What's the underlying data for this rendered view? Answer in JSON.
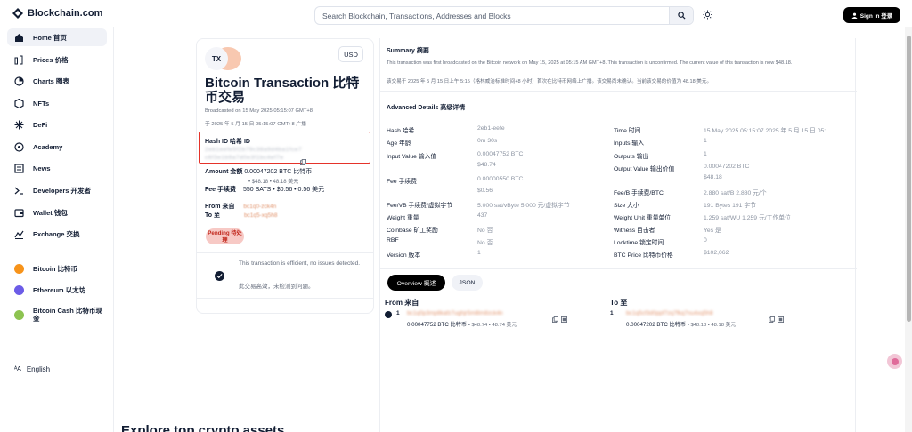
{
  "brand": {
    "name": "Blockchain.com",
    "color": "#121d33"
  },
  "search": {
    "placeholder": "Search Blockchain, Transactions, Addresses and Blocks"
  },
  "header": {
    "sign_in": "Sign In 登录"
  },
  "sidebar": {
    "items": [
      {
        "label": "Home 首页",
        "icon": "home-icon"
      },
      {
        "label": "Prices 价格",
        "icon": "prices-icon"
      },
      {
        "label": "Charts 图表",
        "icon": "charts-icon"
      },
      {
        "label": "NFTs",
        "icon": "nft-icon"
      },
      {
        "label": "DeFi",
        "icon": "defi-icon"
      },
      {
        "label": "Academy",
        "icon": "academy-icon"
      },
      {
        "label": "News",
        "icon": "news-icon"
      },
      {
        "label": "Developers 开发者",
        "icon": "terminal-icon"
      },
      {
        "label": "Wallet 钱包",
        "icon": "wallet-icon"
      },
      {
        "label": "Exchange 交换",
        "icon": "exchange-icon"
      }
    ],
    "coins": [
      {
        "label": "Bitcoin 比特币",
        "color": "#f7931a"
      },
      {
        "label": "Ethereum 以太坊",
        "color": "#6c5ce7"
      },
      {
        "label": "Bitcoin Cash 比特币现金",
        "color": "#8dc351"
      }
    ],
    "language": "English"
  },
  "tx": {
    "badge": "TX",
    "currency": "USD",
    "title": "Bitcoin Transaction 比特币交易",
    "broadcast_en": "Broadcasted on 15 May 2025 05:15:07 GMT+8",
    "broadcast_zh": "于 2025 年 5 月 15 日 05:15:07 GMT+8 广播",
    "hash_label": "Hash ID 哈希 ID",
    "hash_value_1": "2eb1eefe5f2b79c38a9d4ba1fce7",
    "hash_value_2": "c6f3e1b9a7d0e3f1bc4ef7e",
    "amount_label": "Amount 金额",
    "amount_value": "0.00047202 BTC 比特币",
    "amount_usd": "• $48.18 • 48.18 美元",
    "fee_label": "Fee 手续费",
    "fee_value": "550 SATS • $0.56 • 0.56 美元",
    "from_label": "From 来自",
    "from_value": "bc1q0-zck4n",
    "to_label": "To 至",
    "to_value": "bc1q5-xq5h8",
    "status": "Pending 待处理",
    "efficient_en": "This transaction is efficient, no issues detected.",
    "efficient_zh": "此交易高效，未检测到问题。"
  },
  "summary": {
    "title": "Summary 摘要",
    "text_en": "This transaction was first broadcasted on the Bitcoin network on May 15, 2025 at 05:15 AM GMT+8. This transaction is unconfirmed. The current value of this transaction is now $48.18.",
    "text_zh": "该交易于 2025 年 5 月 15 日上午 5:15（格林威治标准时间+8 小时）首次在比特币网络上广播。该交易尚未确认。当前该交易的价值为 48.18 美元。"
  },
  "advanced": {
    "title": "Advanced Details 高级详情",
    "left": [
      {
        "k": "Hash 哈希",
        "v": "2eb1-eefe"
      },
      {
        "k": "Age 年龄",
        "v": "0m 30s"
      },
      {
        "k": "Input Value 输入值",
        "v": "0.00047752 BTC",
        "v2": "$48.74"
      },
      {
        "k": "Fee 手续费",
        "v": "0.00000550 BTC",
        "v2": "$0.56"
      },
      {
        "k": "Fee/VB 手续费/虚拟字节",
        "v": "5.000 sat/vByte 5.000 元/虚拟字节"
      },
      {
        "k": "Weight 重量",
        "v": "437"
      },
      {
        "k": "Coinbase 矿工奖励",
        "v": "No 否"
      },
      {
        "k": "RBF",
        "v": "No 否"
      },
      {
        "k": "Version 版本",
        "v": "1"
      }
    ],
    "right": [
      {
        "k": "Time 时间",
        "v": "15 May 2025 05:15:07 2025 年 5 月 15 日 05:"
      },
      {
        "k": "Inputs 输入",
        "v": "1"
      },
      {
        "k": "Outputs 输出",
        "v": "1"
      },
      {
        "k": "Output Value 输出价值",
        "v": "0.00047202 BTC",
        "v2": "$48.18"
      },
      {
        "k": "Fee/B 手续费/BTC",
        "v": "2.880 sat/B 2.880 元/个"
      },
      {
        "k": "Size 大小",
        "v": "191 Bytes 191 字节"
      },
      {
        "k": "Weight Unit 重量单位",
        "v": "1.259 sat/WU 1.259 元/工作单位"
      },
      {
        "k": "Witness 目击者",
        "v": "Yes 是"
      },
      {
        "k": "Locktime 锁定时间",
        "v": "0"
      },
      {
        "k": "BTC Price 比特币价格",
        "v": "$102,062"
      }
    ]
  },
  "tabs": {
    "overview": "Overview 概述",
    "json": "JSON"
  },
  "io": {
    "from_title": "From 来自",
    "to_title": "To 至",
    "from_index": "1",
    "to_index": "1",
    "from_addr": "bc1q0p3mp8kafz7ughjr5ml8m8zck4n",
    "to_addr": "bc1q5cf3d0ppf7zq7fkq7nu4xq5h8",
    "from_amount": "0.00047752 BTC 比特币",
    "from_usd": "• $48.74 • 48.74 美元",
    "to_amount": "0.00047202 BTC 比特币",
    "to_usd": "• $48.18 • 48.18 美元"
  },
  "explore": "Explore top crypto assets"
}
